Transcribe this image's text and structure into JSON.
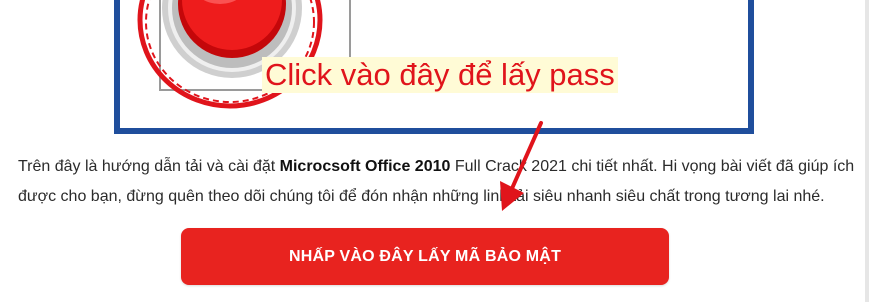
{
  "image": {
    "annotation_text": "Click vào đây để lấy pass",
    "button_icon": "red-push-button-icon"
  },
  "article": {
    "intro": "Trên đây là hướng dẫn tải và cài đặt ",
    "product_name": "Microcsoft Office 2010",
    "rest": " Full Crack 2021 chi tiết nhất. Hi vọng bài viết đã giúp ích được cho bạn, đừng quên theo dõi chúng tôi để đón nhận những link tải siêu nhanh siêu chất trong tương lai nhé."
  },
  "cta": {
    "label": "NHẤP VÀO ĐÂY LẤY MÃ BẢO MẬT"
  },
  "colors": {
    "accent_red": "#e8231f",
    "frame_blue": "#1f4e9c",
    "annotation_red": "#e0141b",
    "highlight_yellow": "#fffbd6"
  }
}
